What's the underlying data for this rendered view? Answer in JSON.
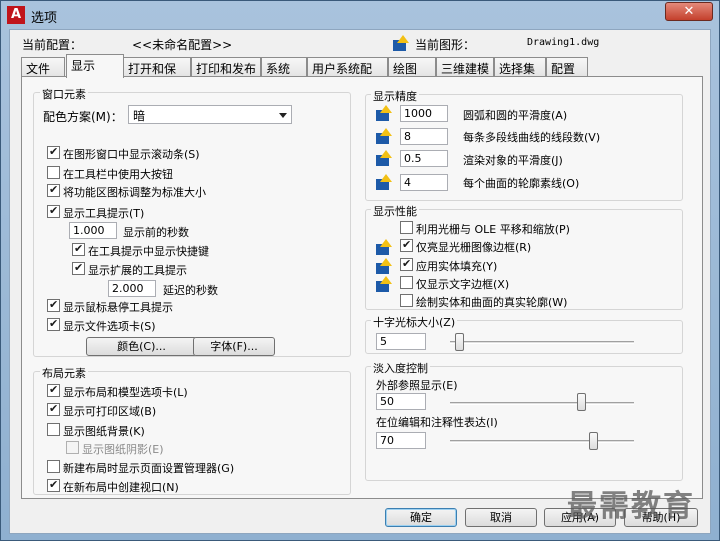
{
  "window": {
    "title": "选项",
    "close_glyph": "✕"
  },
  "profile": {
    "current_profile_label": "当前配置：",
    "current_profile_value": "<<未命名配置>>",
    "current_drawing_label": "当前图形：",
    "current_drawing_value": "Drawing1.dwg"
  },
  "tabs": [
    {
      "label": "文件"
    },
    {
      "label": "显示"
    },
    {
      "label": "打开和保存"
    },
    {
      "label": "打印和发布"
    },
    {
      "label": "系统"
    },
    {
      "label": "用户系统配置"
    },
    {
      "label": "绘图"
    },
    {
      "label": "三维建模"
    },
    {
      "label": "选择集"
    },
    {
      "label": "配置"
    }
  ],
  "window_elements": {
    "title": "窗口元素",
    "color_scheme_label": "配色方案(M)：",
    "color_scheme_value": "暗",
    "show_scrollbars": "在图形窗口中显示滚动条(S)",
    "large_toolbar_buttons": "在工具栏中使用大按钮",
    "resize_ribbon_icons": "将功能区图标调整为标准大小",
    "show_tooltips": "显示工具提示(T)",
    "tooltip_delay_value": "1.000",
    "tooltip_delay_label": "显示前的秒数",
    "show_shortcut_keys": "在工具提示中显示快捷键",
    "show_extended_tooltips": "显示扩展的工具提示",
    "extended_delay_value": "2.000",
    "extended_delay_label": "延迟的秒数",
    "show_rollover_tooltips": "显示鼠标悬停工具提示",
    "show_file_tabs": "显示文件选项卡(S)",
    "colors_button": "颜色(C)...",
    "fonts_button": "字体(F)..."
  },
  "layout_elements": {
    "title": "布局元素",
    "show_layout_tabs": "显示布局和模型选项卡(L)",
    "show_printable_area": "显示可打印区域(B)",
    "show_paper_background": "显示图纸背景(K)",
    "show_paper_shadow": "显示图纸阴影(E)",
    "show_page_setup_manager": "新建布局时显示页面设置管理器(G)",
    "create_viewport": "在新布局中创建视口(N)"
  },
  "display_resolution": {
    "title": "显示精度",
    "arc_smoothness_value": "1000",
    "arc_smoothness_label": "圆弧和圆的平滑度(A)",
    "polyline_segments_value": "8",
    "polyline_segments_label": "每条多段线曲线的线段数(V)",
    "rendered_smoothness_value": "0.5",
    "rendered_smoothness_label": "渲染对象的平滑度(J)",
    "contour_lines_value": "4",
    "contour_lines_label": "每个曲面的轮廓素线(O)"
  },
  "display_performance": {
    "title": "显示性能",
    "raster_pan_zoom": "利用光栅与 OLE 平移和缩放(P)",
    "highlight_raster_frame": "仅亮显光栅图像边框(R)",
    "apply_solid_fill": "应用实体填充(Y)",
    "text_boundary_frame": "仅显示文字边框(X)",
    "true_silhouettes": "绘制实体和曲面的真实轮廓(W)"
  },
  "crosshair": {
    "title": "十字光标大小(Z)",
    "value": "5",
    "level": 5
  },
  "fade_control": {
    "title": "淡入度控制",
    "xref_label": "外部参照显示(E)",
    "xref_value": "50",
    "xref_level": 50,
    "inplace_label": "在位编辑和注释性表达(I)",
    "inplace_value": "70",
    "inplace_level": 70
  },
  "footer": {
    "ok": "确定",
    "cancel": "取消",
    "apply": "应用(A)",
    "help": "帮助(H)"
  },
  "watermark": "最需教育"
}
